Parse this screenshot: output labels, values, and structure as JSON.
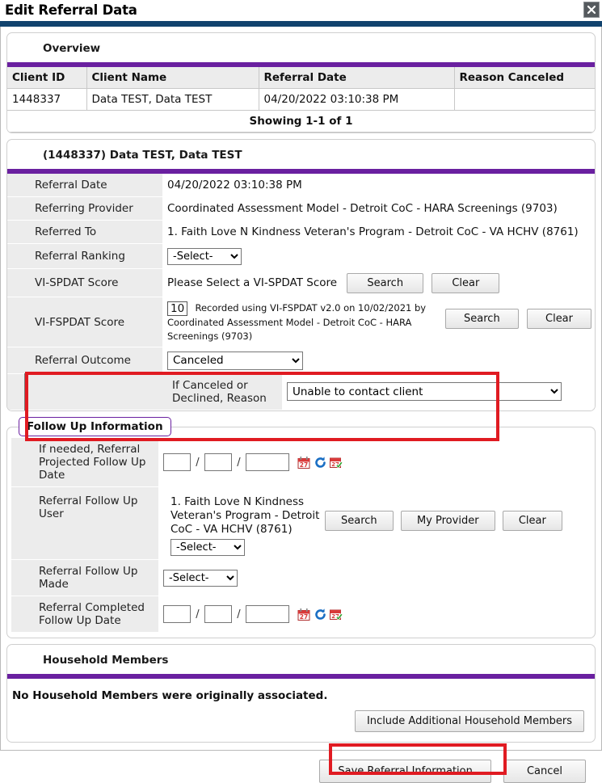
{
  "window": {
    "title": "Edit Referral Data",
    "close_icon": "close-icon"
  },
  "overview": {
    "heading": "Overview",
    "columns": [
      "Client ID",
      "Client Name",
      "Referral Date",
      "Reason Canceled"
    ],
    "rows": [
      {
        "client_id": "1448337",
        "client_name": "Data TEST, Data TEST",
        "referral_date": "04/20/2022 03:10:38 PM",
        "reason_canceled": ""
      }
    ],
    "showing": "Showing 1-1 of 1"
  },
  "detail": {
    "heading": "(1448337) Data TEST, Data TEST",
    "referral_date": {
      "label": "Referral Date",
      "value": "04/20/2022 03:10:38 PM"
    },
    "referring_provider": {
      "label": "Referring Provider",
      "value": "Coordinated Assessment Model - Detroit CoC - HARA Screenings (9703)"
    },
    "referred_to": {
      "label": "Referred To",
      "value": "1. Faith Love N Kindness Veteran's Program - Detroit CoC - VA HCHV (8761)"
    },
    "referral_ranking": {
      "label": "Referral Ranking",
      "value": "-Select-"
    },
    "vi_spdat": {
      "label": "VI-SPDAT Score",
      "value": "Please Select a VI-SPDAT Score",
      "search_label": "Search",
      "clear_label": "Clear"
    },
    "vi_fspdat": {
      "label": "VI-FSPDAT Score",
      "score": "10",
      "description": "Recorded using VI-FSPDAT v2.0 on 10/02/2021 by Coordinated Assessment Model - Detroit CoC - HARA Screenings (9703)",
      "search_label": "Search",
      "clear_label": "Clear"
    },
    "referral_outcome": {
      "label": "Referral Outcome",
      "value": "Canceled"
    },
    "cancel_reason": {
      "label": "If Canceled or Declined, Reason",
      "value": "Unable to contact client"
    }
  },
  "followup": {
    "legend": "Follow Up Information",
    "projected_date": {
      "label": "If needed, Referral Projected Follow Up Date",
      "month": "",
      "day": "",
      "year": ""
    },
    "followup_user": {
      "label": "Referral Follow Up User",
      "value": "1. Faith Love N Kindness Veteran's Program - Detroit CoC - VA HCHV (8761)",
      "select_value": "-Select-",
      "search_label": "Search",
      "my_provider_label": "My Provider",
      "clear_label": "Clear"
    },
    "followup_made": {
      "label": "Referral Follow Up Made",
      "value": "-Select-"
    },
    "completed_date": {
      "label": "Referral Completed Follow Up Date",
      "month": "",
      "day": "",
      "year": ""
    },
    "icons": [
      "calendar-icon",
      "refresh-icon",
      "calendar-check-icon"
    ]
  },
  "household": {
    "heading": "Household Members",
    "message": "No Household Members were originally associated.",
    "include_button": "Include Additional Household Members"
  },
  "footer": {
    "save_label": "Save Referral Information",
    "cancel_label": "Cancel"
  },
  "colors": {
    "accent_purple": "#6a20a0",
    "title_rule_blue": "#11436e",
    "highlight_red": "#e01b22"
  }
}
